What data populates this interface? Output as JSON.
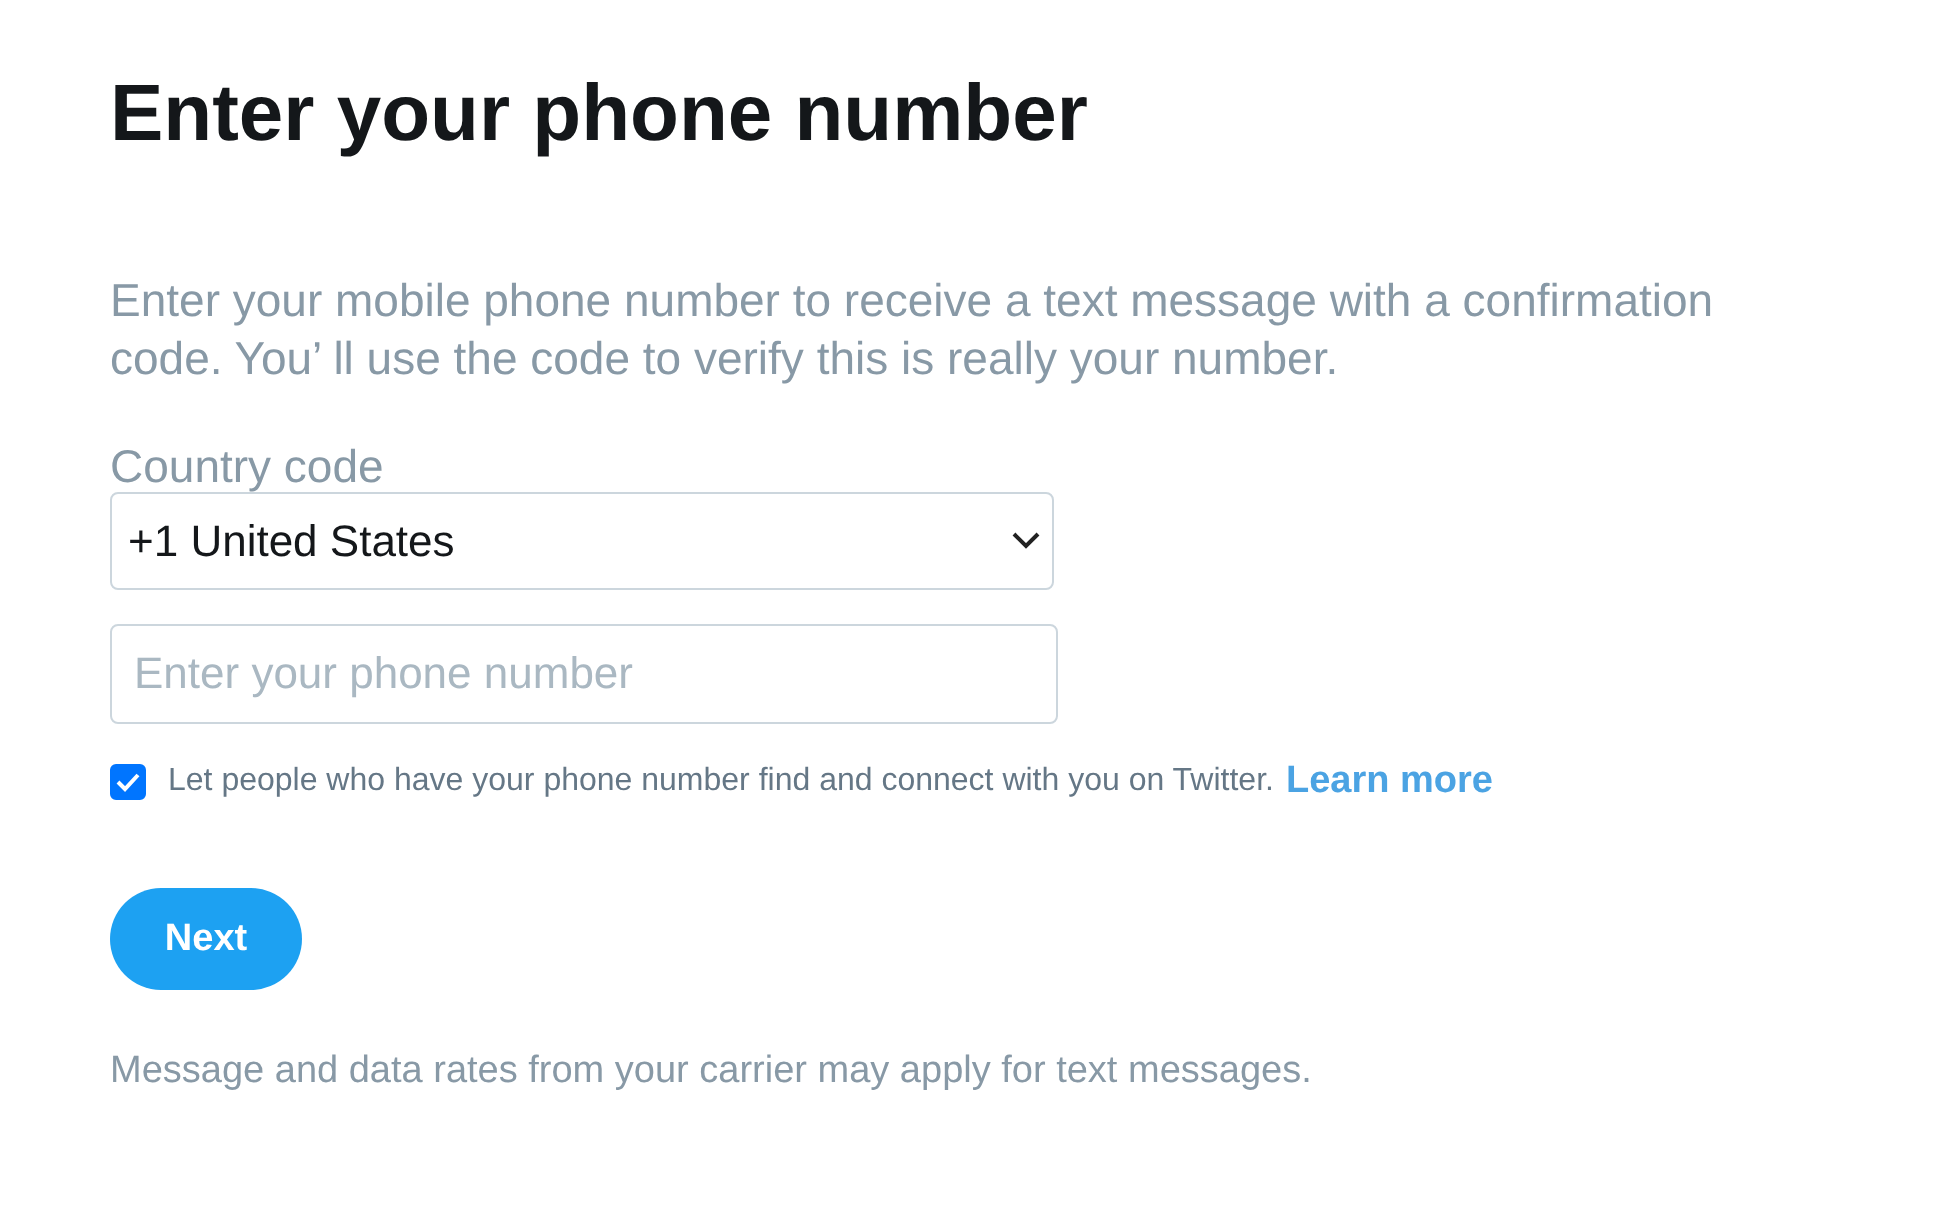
{
  "title": "Enter your phone number",
  "description": "Enter your mobile phone number to receive a text message with a confirmation code. You’ ll use the code to verify this is really your number.",
  "country": {
    "label": "Country code",
    "value": "+1 United States"
  },
  "phone": {
    "placeholder": "Enter your phone number"
  },
  "discoverable": {
    "checked": true,
    "label": "Let people who have your phone number find and connect with you on Twitter.",
    "link": "Learn more"
  },
  "buttons": [
    "Next"
  ],
  "footer": "Message and data rates from your carrier may apply for text messages."
}
